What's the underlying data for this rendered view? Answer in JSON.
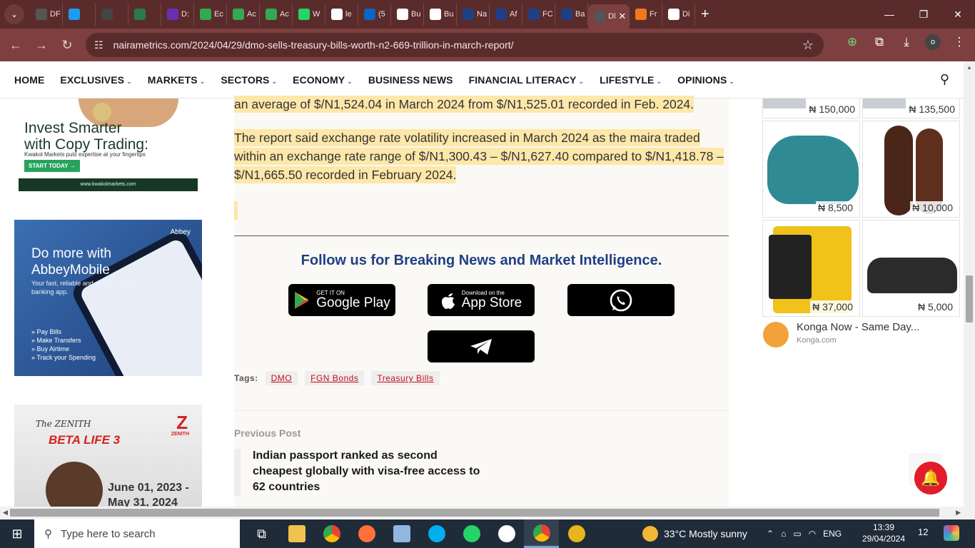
{
  "browser": {
    "tabs": [
      {
        "icon": "tab-favicon-df",
        "label": "DF",
        "color": "#555555"
      },
      {
        "icon": "tab-favicon-salesforce",
        "label": "",
        "color": "#1d9bf0"
      },
      {
        "icon": "tab-favicon-colorful",
        "label": "",
        "color": "#444444"
      },
      {
        "icon": "tab-favicon-map",
        "label": "",
        "color": "#2a7a4b"
      },
      {
        "icon": "tab-favicon-h",
        "label": "D:",
        "color": "#6b2fb3"
      },
      {
        "icon": "tab-favicon-green",
        "label": "Ec",
        "color": "#35a853"
      },
      {
        "icon": "tab-favicon-green",
        "label": "Ac",
        "color": "#35a853"
      },
      {
        "icon": "tab-favicon-green",
        "label": "Ac",
        "color": "#35a853"
      },
      {
        "icon": "tab-favicon-whatsapp",
        "label": "W",
        "color": "#25d366"
      },
      {
        "icon": "tab-favicon-doc",
        "label": "le",
        "color": "#ffffff"
      },
      {
        "icon": "tab-favicon-linkedin",
        "label": "(5",
        "color": "#0a66c2"
      },
      {
        "icon": "tab-favicon-google",
        "label": "Bu",
        "color": "#ffffff"
      },
      {
        "icon": "tab-favicon-google",
        "label": "Bu",
        "color": "#ffffff"
      },
      {
        "icon": "tab-favicon-n",
        "label": "Na",
        "color": "#1f3f85"
      },
      {
        "icon": "tab-favicon-n",
        "label": "Af",
        "color": "#1f3f85"
      },
      {
        "icon": "tab-favicon-n",
        "label": "FC",
        "color": "#1f3f85"
      },
      {
        "icon": "tab-favicon-n",
        "label": "Ba",
        "color": "#1f3f85"
      }
    ],
    "active_tab_label": "Dl",
    "tabs_after": [
      {
        "icon": "tab-favicon-a",
        "label": "Fr",
        "color": "#f07a1a"
      },
      {
        "icon": "tab-favicon-google",
        "label": "Di",
        "color": "#ffffff"
      }
    ],
    "url": "nairametrics.com/2024/04/29/dmo-sells-treasury-bills-worth-n2-669-trillion-in-march-report/",
    "profile_initial": "o"
  },
  "nav": {
    "items": [
      {
        "label": "HOME",
        "has_menu": false
      },
      {
        "label": "EXCLUSIVES",
        "has_menu": true
      },
      {
        "label": "MARKETS",
        "has_menu": true
      },
      {
        "label": "SECTORS",
        "has_menu": true
      },
      {
        "label": "ECONOMY",
        "has_menu": true
      },
      {
        "label": "BUSINESS NEWS",
        "has_menu": false
      },
      {
        "label": "FINANCIAL LITERACY",
        "has_menu": true
      },
      {
        "label": "LIFESTYLE",
        "has_menu": true
      },
      {
        "label": "OPINIONS",
        "has_menu": true
      }
    ]
  },
  "article": {
    "para1": "an average of $/N1,524.04 in March 2024 from $/N1,525.01 recorded in Feb. 2024.",
    "para2": "The report said exchange rate volatility increased in March 2024 as the maira traded within an exchange rate range of $/N1,300.43 – $/N1,627.40 compared to $/N1,418.78 – $/N1,665.50 recorded in February 2024.",
    "follow_heading": "Follow us for Breaking News and Market Intelligence.",
    "google_play_small": "GET IT ON",
    "google_play_big": "Google Play",
    "app_store_small": "Download on the",
    "app_store_big": "App Store",
    "tags_label": "Tags:",
    "tags": [
      "DMO",
      "FGN Bonds",
      "Treasury Bills"
    ],
    "previous_label": "Previous Post",
    "previous_title": "Indian passport ranked as second cheapest globally with visa-free access to 62 countries"
  },
  "left_ads": {
    "ad1": {
      "headline_line1": "Invest Smarter",
      "headline_line2": "with Copy Trading:",
      "sub": "Kwakol Markets puts expertise at your fingertips",
      "cta": "START TODAY →",
      "footer": "www.kwakolmarkets.com"
    },
    "ad2": {
      "logo": "Abbey",
      "headline_line1": "Do more with",
      "headline_line2": "AbbeyMobile",
      "sub": "Your fast, reliable and secure mobile banking app.",
      "features": [
        "» Pay Bills",
        "» Make Transfers",
        "» Buy Airtime",
        "» Track your Spending"
      ]
    },
    "ad3": {
      "script": "The ZENITH",
      "title": "BETA LIFE 3",
      "brand": "ZENITH",
      "dates_line1": "June 01, 2023 -",
      "dates_line2": "May 31, 2024"
    }
  },
  "right_ads": {
    "top_prices": [
      "₦ 150,000",
      "₦ 135,500"
    ],
    "products": [
      {
        "name": "slipper",
        "price": "₦ 8,500"
      },
      {
        "name": "shoe",
        "price": "₦ 10,000"
      },
      {
        "name": "welder",
        "price": "₦ 37,000"
      },
      {
        "name": "brush-set",
        "price": "₦ 5,000"
      }
    ],
    "konga_title": "Konga Now - Same Day...",
    "konga_source": "Konga.com"
  },
  "taskbar": {
    "search_placeholder": "Type here to search",
    "weather": "33°C  Mostly sunny",
    "language": "ENG",
    "time": "13:39",
    "date": "29/04/2024",
    "notification_count": "12"
  }
}
